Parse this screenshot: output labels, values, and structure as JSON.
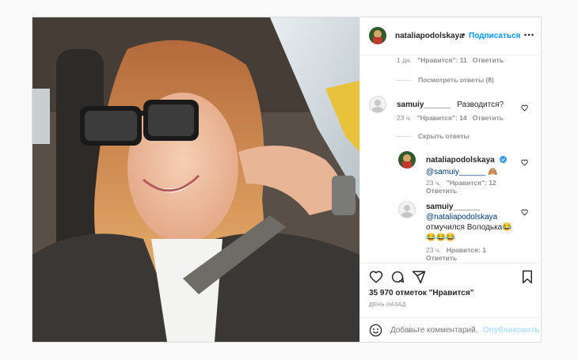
{
  "post": {
    "username": "nataliapodolskaya",
    "dot": "•",
    "follow_label": "Подписаться",
    "more_icon": "more-horizontal-icon"
  },
  "comments": {
    "top_meta": {
      "time": "1 дн.",
      "likes": "\"Нравится\": 11",
      "reply": "Ответить"
    },
    "view_replies": "Посмотреть ответы (8)",
    "c1": {
      "username": "samuiy______",
      "text": "Разводится?",
      "time": "23 ч.",
      "likes": "\"Нравится\": 14",
      "reply": "Ответить"
    },
    "hide_replies": "Скрыть ответы",
    "r1": {
      "username": "nataliapodolskaya",
      "mention": "@samuiy______",
      "emoji": "🙈",
      "time": "23 ч.",
      "likes": "\"Нравится\": 12",
      "reply": "Ответить"
    },
    "r2": {
      "username": "samuiy______",
      "mention": "@nataliapodolskaya",
      "text": "отмучился Володька😂",
      "emoji_line": "😂😂😂",
      "time": "23 ч.",
      "likes": "Нравится: 1",
      "reply": "Ответить"
    }
  },
  "actions": {
    "likes_count": "35 970 отметок \"Нравится\"",
    "date": "ДЕНЬ НАЗАД"
  },
  "add_comment": {
    "placeholder": "Добавьте комментарий...",
    "publish_label": "Опубликовать"
  },
  "colors": {
    "accent": "#0095f6",
    "verified": "#3897f0"
  }
}
